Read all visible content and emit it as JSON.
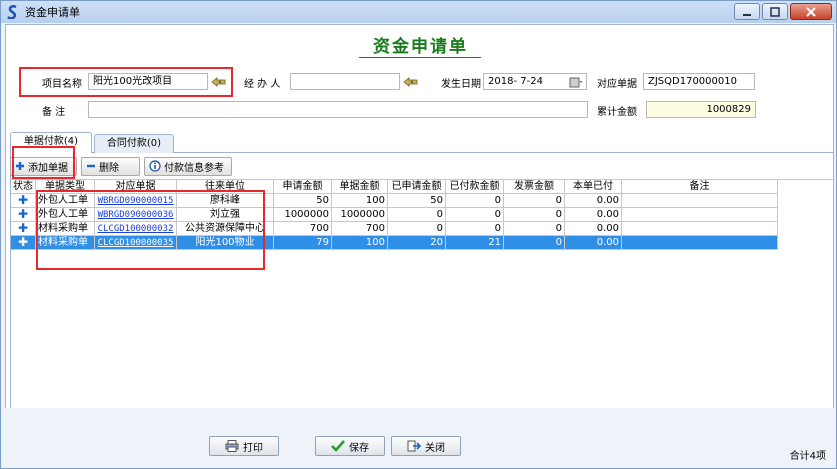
{
  "window": {
    "title": "资金申请单",
    "buttons": [
      "minimize",
      "maximize",
      "close"
    ]
  },
  "form": {
    "title": "资金申请单",
    "project_name_label": "项目名称",
    "project_name_value": "阳光100光改项目",
    "handler_label": "经 办 人",
    "handler_value": "",
    "date_label": "发生日期",
    "date_value": "2018- 7-24",
    "doc_label": "对应单据",
    "doc_value": "ZJSQD170000010",
    "remark_label": "备    注",
    "remark_value": "",
    "total_label": "累计金额",
    "total_value": "1000829"
  },
  "tabs": [
    {
      "label": "单据付款(4)",
      "active": true
    },
    {
      "label": "合同付款(0)",
      "active": false
    }
  ],
  "toolbar": {
    "add_label": "添加单据",
    "delete_label": "删除",
    "payinfo_label": "付款信息参考"
  },
  "grid": {
    "headers": [
      "状态",
      "单据类型",
      "对应单据",
      "往来单位",
      "申请金额",
      "单据金额",
      "已申请金额",
      "已付款金额",
      "发票金额",
      "本单已付",
      "备注"
    ],
    "rows": [
      {
        "type": "外包人工单",
        "doc": "WBRGD090000015",
        "unit": "廖科峰",
        "apply": "50",
        "doc_amount": "100",
        "applied": "50",
        "paid": "0",
        "invoice": "0",
        "this_paid": "0.00",
        "remark": "",
        "selected": false
      },
      {
        "type": "外包人工单",
        "doc": "WBRGD090000036",
        "unit": "刘立强",
        "apply": "1000000",
        "doc_amount": "1000000",
        "applied": "0",
        "paid": "0",
        "invoice": "0",
        "this_paid": "0.00",
        "remark": "",
        "selected": false
      },
      {
        "type": "材料采购单",
        "doc": "CLCGD100000032",
        "unit": "公共资源保障中心",
        "apply": "700",
        "doc_amount": "700",
        "applied": "0",
        "paid": "0",
        "invoice": "0",
        "this_paid": "0.00",
        "remark": "",
        "selected": false
      },
      {
        "type": "材料采购单",
        "doc": "CLCGD100000035",
        "unit": "阳光100物业",
        "apply": "79",
        "doc_amount": "100",
        "applied": "20",
        "paid": "21",
        "invoice": "0",
        "this_paid": "0.00",
        "remark": "",
        "selected": true
      }
    ]
  },
  "bottom": {
    "print_label": "打印",
    "save_label": "保存",
    "close_label": "关闭",
    "total_count": "合计4项"
  },
  "colors": {
    "title_green": "#1a7b1a",
    "highlight_red": "#e8282e",
    "selected_row": "#2f8ee6",
    "link_blue": "#1a3ed8"
  }
}
